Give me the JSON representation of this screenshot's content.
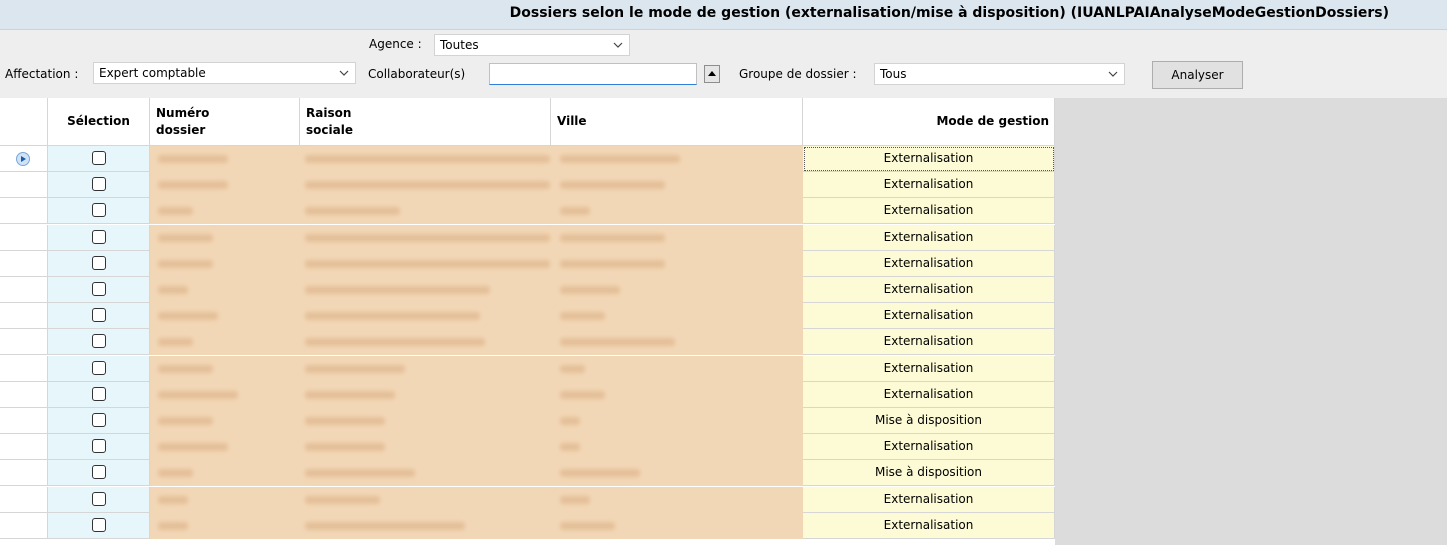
{
  "window": {
    "title": "Dossiers selon le mode de gestion (externalisation/mise à disposition) (IUANLPAIAnalyseModeGestionDossiers)"
  },
  "filters": {
    "agence_label": "Agence :",
    "agence_value": "Toutes",
    "affectation_label": "Affectation :",
    "affectation_value": "Expert comptable",
    "collaborateur_label": "Collaborateur(s)",
    "collaborateur_value": "",
    "groupe_label": "Groupe de dossier :",
    "groupe_value": "Tous",
    "analyser_label": "Analyser"
  },
  "grid": {
    "columns": [
      "Sélection",
      "Numéro\ndossier",
      "Raison\nsociale",
      "Ville",
      "Mode de gestion"
    ],
    "rows": [
      {
        "mode": "Externalisation"
      },
      {
        "mode": "Externalisation"
      },
      {
        "mode": "Externalisation"
      },
      {
        "mode": "Externalisation"
      },
      {
        "mode": "Externalisation"
      },
      {
        "mode": "Externalisation"
      },
      {
        "mode": "Externalisation"
      },
      {
        "mode": "Externalisation"
      },
      {
        "mode": "Externalisation"
      },
      {
        "mode": "Externalisation"
      },
      {
        "mode": "Mise à disposition"
      },
      {
        "mode": "Externalisation"
      },
      {
        "mode": "Mise à disposition"
      },
      {
        "mode": "Externalisation"
      },
      {
        "mode": "Externalisation"
      }
    ]
  },
  "colors": {
    "titlebar": "#dbe6ef",
    "filters_bg": "#eeeeee",
    "selection_col": "#e6f6fb",
    "blurred_cols": "#f2d7b6",
    "mode_col": "#fdfbd6",
    "side_panel": "#dcdcdc"
  }
}
